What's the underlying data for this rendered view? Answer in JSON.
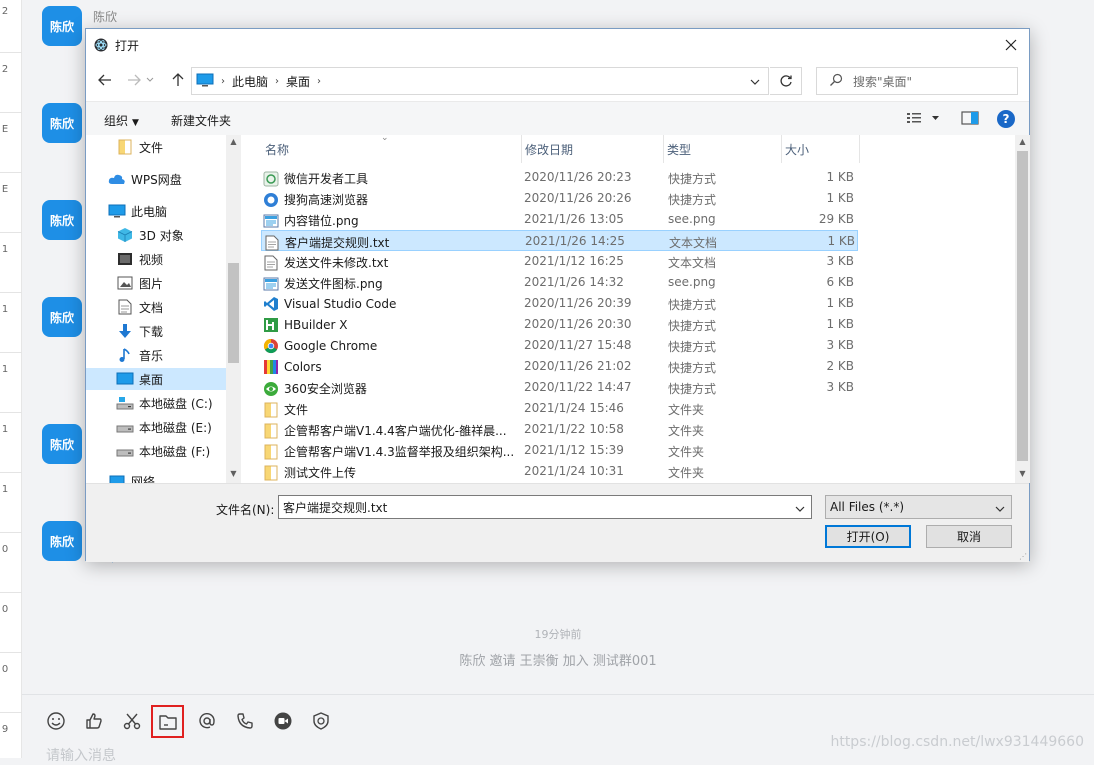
{
  "left_strip": [
    "2",
    "2",
    "E",
    "E",
    "1",
    "1",
    "1",
    "1",
    "1",
    "0",
    "0",
    "0",
    "9"
  ],
  "chat": {
    "sender_name": "陈欣",
    "avatar_label": "陈欣",
    "sys_time": "19分钟前",
    "sys_message": "陈欣 邀请 王崇衡 加入 测试群001"
  },
  "composer": {
    "tools": [
      "emoji-icon",
      "thumbs-up-icon",
      "scissors-icon",
      "folder-icon",
      "at-icon",
      "phone-icon",
      "video-icon",
      "shield-icon"
    ],
    "selected_tool": "folder-icon",
    "placeholder": "请输入消息"
  },
  "watermark": "https://blog.csdn.net/lwx931449660",
  "dialog": {
    "title": "打开",
    "address": [
      "此电脑",
      "桌面"
    ],
    "search_placeholder": "搜索\"桌面\"",
    "toolbar": {
      "organize": "组织",
      "new_folder": "新建文件夹"
    },
    "nav_items": [
      {
        "label": "文件",
        "icon": "folder-icon",
        "selected": false
      },
      {
        "label": "WPS网盘",
        "icon": "cloud-icon",
        "selected": false
      },
      {
        "label": "此电脑",
        "icon": "computer-icon",
        "selected": false
      },
      {
        "label": "3D 对象",
        "icon": "cube-icon",
        "selected": false
      },
      {
        "label": "视频",
        "icon": "video-folder-icon",
        "selected": false
      },
      {
        "label": "图片",
        "icon": "pictures-folder-icon",
        "selected": false
      },
      {
        "label": "文档",
        "icon": "documents-folder-icon",
        "selected": false
      },
      {
        "label": "下载",
        "icon": "download-folder-icon",
        "selected": false
      },
      {
        "label": "音乐",
        "icon": "music-folder-icon",
        "selected": false
      },
      {
        "label": "桌面",
        "icon": "desktop-folder-icon",
        "selected": true
      },
      {
        "label": "本地磁盘 (C:)",
        "icon": "drive-icon",
        "selected": false
      },
      {
        "label": "本地磁盘 (E:)",
        "icon": "drive-icon",
        "selected": false
      },
      {
        "label": "本地磁盘 (F:)",
        "icon": "drive-icon",
        "selected": false
      },
      {
        "label": "网络",
        "icon": "network-icon",
        "selected": false
      }
    ],
    "columns": {
      "name": "名称",
      "date": "修改日期",
      "type": "类型",
      "size": "大小"
    },
    "files": [
      {
        "name": "微信开发者工具",
        "date": "2020/11/26 20:23",
        "type": "快捷方式",
        "size": "1 KB",
        "icon": "wechat-devtools-icon",
        "selected": false
      },
      {
        "name": "搜狗高速浏览器",
        "date": "2020/11/26 20:26",
        "type": "快捷方式",
        "size": "1 KB",
        "icon": "sogou-browser-icon",
        "selected": false
      },
      {
        "name": "内容错位.png",
        "date": "2021/1/26 13:05",
        "type": "see.png",
        "size": "29 KB",
        "icon": "image-file-icon",
        "selected": false
      },
      {
        "name": "客户端提交规则.txt",
        "date": "2021/1/26 14:25",
        "type": "文本文档",
        "size": "1 KB",
        "icon": "text-file-icon",
        "selected": true
      },
      {
        "name": "发送文件未修改.txt",
        "date": "2021/1/12 16:25",
        "type": "文本文档",
        "size": "3 KB",
        "icon": "text-file-icon",
        "selected": false
      },
      {
        "name": "发送文件图标.png",
        "date": "2021/1/26 14:32",
        "type": "see.png",
        "size": "6 KB",
        "icon": "image-file-icon",
        "selected": false
      },
      {
        "name": "Visual Studio Code",
        "date": "2020/11/26 20:39",
        "type": "快捷方式",
        "size": "1 KB",
        "icon": "vscode-icon",
        "selected": false
      },
      {
        "name": "HBuilder X",
        "date": "2020/11/26 20:30",
        "type": "快捷方式",
        "size": "1 KB",
        "icon": "hbuilder-icon",
        "selected": false
      },
      {
        "name": "Google Chrome",
        "date": "2020/11/27 15:48",
        "type": "快捷方式",
        "size": "3 KB",
        "icon": "chrome-icon",
        "selected": false
      },
      {
        "name": "Colors",
        "date": "2020/11/26 21:02",
        "type": "快捷方式",
        "size": "2 KB",
        "icon": "colors-icon",
        "selected": false
      },
      {
        "name": "360安全浏览器",
        "date": "2020/11/22 14:47",
        "type": "快捷方式",
        "size": "3 KB",
        "icon": "360-browser-icon",
        "selected": false
      },
      {
        "name": "文件",
        "date": "2021/1/24 15:46",
        "type": "文件夹",
        "size": "",
        "icon": "folder-icon",
        "selected": false
      },
      {
        "name": "企管帮客户端V1.4.4客户端优化-雒祥晨...",
        "date": "2021/1/22 10:58",
        "type": "文件夹",
        "size": "",
        "icon": "folder-icon",
        "selected": false
      },
      {
        "name": "企管帮客户端V1.4.3监督举报及组织架构...",
        "date": "2021/1/12 15:39",
        "type": "文件夹",
        "size": "",
        "icon": "folder-icon",
        "selected": false
      },
      {
        "name": "测试文件上传",
        "date": "2021/1/24 10:31",
        "type": "文件夹",
        "size": "",
        "icon": "folder-icon",
        "selected": false
      }
    ],
    "filename_label": "文件名(N):",
    "filename_value": "客户端提交规则.txt",
    "filter_value": "All Files (*.*)",
    "open_button": "打开(O)",
    "cancel_button": "取消",
    "accent_color": "#0078d7",
    "selection_color": "#cce8ff"
  }
}
